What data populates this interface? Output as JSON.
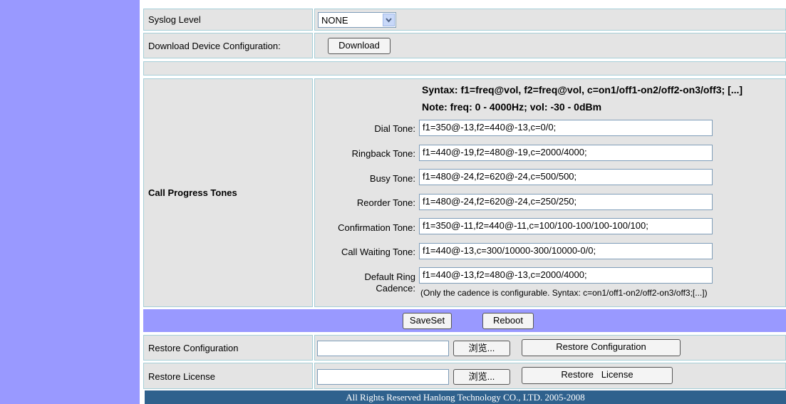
{
  "syslog": {
    "label": "Syslog Level",
    "value": "NONE"
  },
  "download": {
    "label": "Download Device Configuration:",
    "button": "Download"
  },
  "tones": {
    "section_label": "Call Progress Tones",
    "syntax": "Syntax: f1=freq@vol, f2=freq@vol, c=on1/off1-on2/off2-on3/off3; [...]",
    "note": "Note: freq: 0 - 4000Hz; vol: -30 - 0dBm",
    "items": [
      {
        "label": "Dial Tone:",
        "value": "f1=350@-13,f2=440@-13,c=0/0;"
      },
      {
        "label": "Ringback Tone:",
        "value": "f1=440@-19,f2=480@-19,c=2000/4000;"
      },
      {
        "label": "Busy Tone:",
        "value": "f1=480@-24,f2=620@-24,c=500/500;"
      },
      {
        "label": "Reorder Tone:",
        "value": "f1=480@-24,f2=620@-24,c=250/250;"
      },
      {
        "label": "Confirmation Tone:",
        "value": "f1=350@-11,f2=440@-11,c=100/100-100/100-100/100;"
      },
      {
        "label": "Call Waiting Tone:",
        "value": "f1=440@-13,c=300/10000-300/10000-0/0;"
      }
    ],
    "default_ring": {
      "label_line1": "Default Ring",
      "label_line2": "Cadence:",
      "value": "f1=440@-13,f2=480@-13,c=2000/4000;",
      "hint": "(Only the cadence is configurable. Syntax: c=on1/off1-on2/off2-on3/off3;[...])"
    }
  },
  "actions": {
    "saveset": "SaveSet",
    "reboot": "Reboot"
  },
  "restore_config": {
    "label": "Restore Configuration",
    "browse": "浏览...",
    "button": "Restore Configuration"
  },
  "restore_license": {
    "label": "Restore License",
    "browse": "浏览...",
    "button": "Restore   License"
  },
  "footer": "All Rights Reserved Hanlong Technology CO., LTD. 2005-2008",
  "colors": {
    "sidebar": "#9999ff",
    "cell": "#e4e4e4",
    "action_bar": "#9999ff",
    "footer": "#2f618d"
  }
}
